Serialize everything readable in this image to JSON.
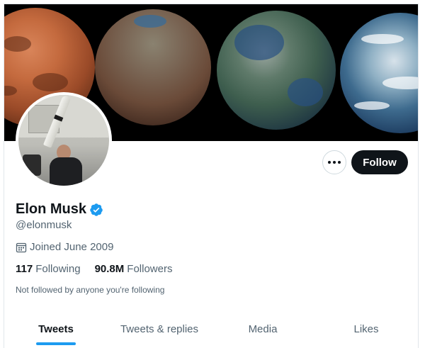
{
  "profile": {
    "name": "Elon Musk",
    "handle": "@elonmusk",
    "joined": "Joined June 2009",
    "following_count": "117",
    "following_label": "Following",
    "followers_count": "90.8M",
    "followers_label": "Followers",
    "followed_note": "Not followed by anyone you're following",
    "verified": true
  },
  "actions": {
    "follow_label": "Follow",
    "more_icon": "more-horizontal-icon"
  },
  "tabs": [
    {
      "label": "Tweets",
      "active": true
    },
    {
      "label": "Tweets & replies",
      "active": false
    },
    {
      "label": "Media",
      "active": false
    },
    {
      "label": "Likes",
      "active": false
    }
  ],
  "colors": {
    "accent": "#1d9bf0",
    "text_primary": "#0f1419",
    "text_secondary": "#536471",
    "button_dark": "#0f1419"
  }
}
